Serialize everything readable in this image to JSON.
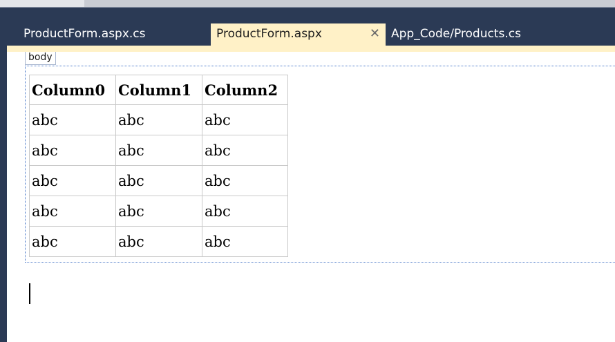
{
  "tabs": [
    {
      "label": "ProductForm.aspx.cs",
      "active": false
    },
    {
      "label": "ProductForm.aspx",
      "active": true,
      "close_glyph": "✕"
    },
    {
      "label": "App_Code/Products.cs",
      "active": false
    }
  ],
  "designer": {
    "tag_label": "body",
    "table": {
      "headers": [
        "Column0",
        "Column1",
        "Column2"
      ],
      "rows": [
        [
          "abc",
          "abc",
          "abc"
        ],
        [
          "abc",
          "abc",
          "abc"
        ],
        [
          "abc",
          "abc",
          "abc"
        ],
        [
          "abc",
          "abc",
          "abc"
        ],
        [
          "abc",
          "abc",
          "abc"
        ]
      ]
    }
  },
  "colors": {
    "tabbar_bg": "#2b3a55",
    "active_tab_bg": "#fff1c7",
    "frame_border": "#4a79c9"
  },
  "icons": {
    "close": "close-icon"
  }
}
